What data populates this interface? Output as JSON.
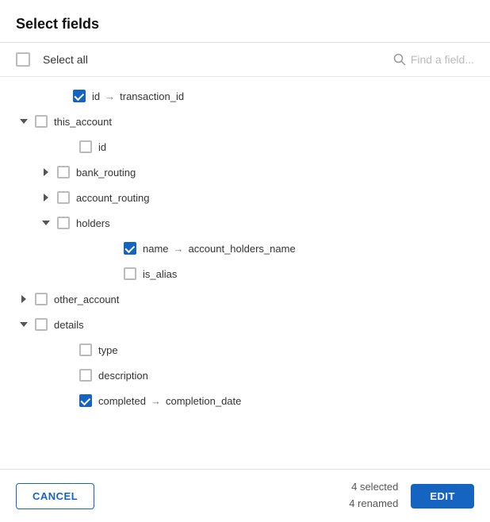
{
  "header": {
    "title": "Select fields"
  },
  "toolbar": {
    "select_all_label": "Select all",
    "search_placeholder": "Find a field..."
  },
  "fields": [
    {
      "id": "id-row",
      "indent": 1,
      "has_expander": false,
      "checked": true,
      "name": "id",
      "arrow": "→",
      "renamed": "transaction_id",
      "depth": 0
    }
  ],
  "tree": [
    {
      "id": "id-top",
      "indent": "indent-1",
      "expander": false,
      "checked": true,
      "name": "id",
      "arrow": "→",
      "renamed": "transaction_id"
    },
    {
      "id": "this-account",
      "indent": "indent-0",
      "expander": "down",
      "checked": false,
      "name": "this_account",
      "arrow": null,
      "renamed": null
    },
    {
      "id": "this-account-id",
      "indent": "indent-2",
      "expander": false,
      "checked": false,
      "name": "id",
      "arrow": null,
      "renamed": null
    },
    {
      "id": "bank-routing",
      "indent": "indent-1-5",
      "expander": "right",
      "checked": false,
      "name": "bank_routing",
      "arrow": null,
      "renamed": null
    },
    {
      "id": "account-routing",
      "indent": "indent-1-5",
      "expander": "right",
      "checked": false,
      "name": "account_routing",
      "arrow": null,
      "renamed": null
    },
    {
      "id": "holders",
      "indent": "indent-1-5",
      "expander": "down",
      "checked": false,
      "name": "holders",
      "arrow": null,
      "renamed": null
    },
    {
      "id": "holders-name",
      "indent": "indent-3",
      "expander": false,
      "checked": true,
      "name": "name",
      "arrow": "→",
      "renamed": "account_holders_name"
    },
    {
      "id": "holders-is-alias",
      "indent": "indent-3",
      "expander": false,
      "checked": false,
      "name": "is_alias",
      "arrow": null,
      "renamed": null
    },
    {
      "id": "other-account",
      "indent": "indent-0",
      "expander": "right",
      "checked": false,
      "name": "other_account",
      "arrow": null,
      "renamed": null
    },
    {
      "id": "details",
      "indent": "indent-0",
      "expander": "down",
      "checked": false,
      "name": "details",
      "arrow": null,
      "renamed": null
    },
    {
      "id": "details-type",
      "indent": "indent-2",
      "expander": false,
      "checked": false,
      "name": "type",
      "arrow": null,
      "renamed": null
    },
    {
      "id": "details-description",
      "indent": "indent-2",
      "expander": false,
      "checked": false,
      "name": "description",
      "arrow": null,
      "renamed": null
    },
    {
      "id": "details-completed",
      "indent": "indent-2",
      "expander": false,
      "checked": true,
      "name": "completed",
      "arrow": "→",
      "renamed": "completion_date"
    }
  ],
  "footer": {
    "cancel_label": "CANCEL",
    "stats_selected": "4 selected",
    "stats_renamed": "4 renamed",
    "edit_label": "EDIT"
  }
}
